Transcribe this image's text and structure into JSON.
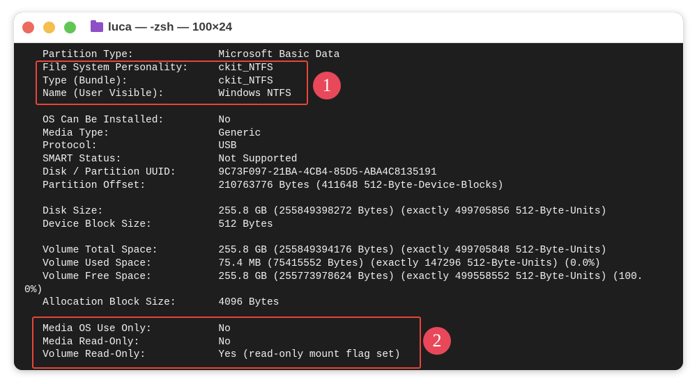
{
  "window": {
    "title": "luca — -zsh — 100×24",
    "folder_icon": "folder-icon"
  },
  "lines": [
    {
      "label": "   Partition Type:",
      "value": "Microsoft Basic Data"
    },
    {
      "label": "   File System Personality:",
      "value": "ckit_NTFS"
    },
    {
      "label": "   Type (Bundle):",
      "value": "ckit_NTFS"
    },
    {
      "label": "   Name (User Visible):",
      "value": "Windows NTFS"
    },
    {
      "label": "",
      "value": ""
    },
    {
      "label": "   OS Can Be Installed:",
      "value": "No"
    },
    {
      "label": "   Media Type:",
      "value": "Generic"
    },
    {
      "label": "   Protocol:",
      "value": "USB"
    },
    {
      "label": "   SMART Status:",
      "value": "Not Supported"
    },
    {
      "label": "   Disk / Partition UUID:",
      "value": "9C73F097-21BA-4CB4-85D5-ABA4C8135191"
    },
    {
      "label": "   Partition Offset:",
      "value": "210763776 Bytes (411648 512-Byte-Device-Blocks)"
    },
    {
      "label": "",
      "value": ""
    },
    {
      "label": "   Disk Size:",
      "value": "255.8 GB (255849398272 Bytes) (exactly 499705856 512-Byte-Units)"
    },
    {
      "label": "   Device Block Size:",
      "value": "512 Bytes"
    },
    {
      "label": "",
      "value": ""
    },
    {
      "label": "   Volume Total Space:",
      "value": "255.8 GB (255849394176 Bytes) (exactly 499705848 512-Byte-Units)"
    },
    {
      "label": "   Volume Used Space:",
      "value": "75.4 MB (75415552 Bytes) (exactly 147296 512-Byte-Units) (0.0%)"
    },
    {
      "label": "   Volume Free Space:",
      "value": "255.8 GB (255773978624 Bytes) (exactly 499558552 512-Byte-Units) (100."
    },
    {
      "label": "0%)",
      "value": ""
    },
    {
      "label": "   Allocation Block Size:",
      "value": "4096 Bytes"
    },
    {
      "label": "",
      "value": ""
    },
    {
      "label": "   Media OS Use Only:",
      "value": "No"
    },
    {
      "label": "   Media Read-Only:",
      "value": "No"
    },
    {
      "label": "   Volume Read-Only:",
      "value": "Yes (read-only mount flag set)"
    }
  ],
  "annotations": [
    {
      "label": "1"
    },
    {
      "label": "2"
    }
  ],
  "colors": {
    "highlight": "#e8453c",
    "badge": "#e8485a",
    "terminal_bg": "#1e1e1e"
  }
}
